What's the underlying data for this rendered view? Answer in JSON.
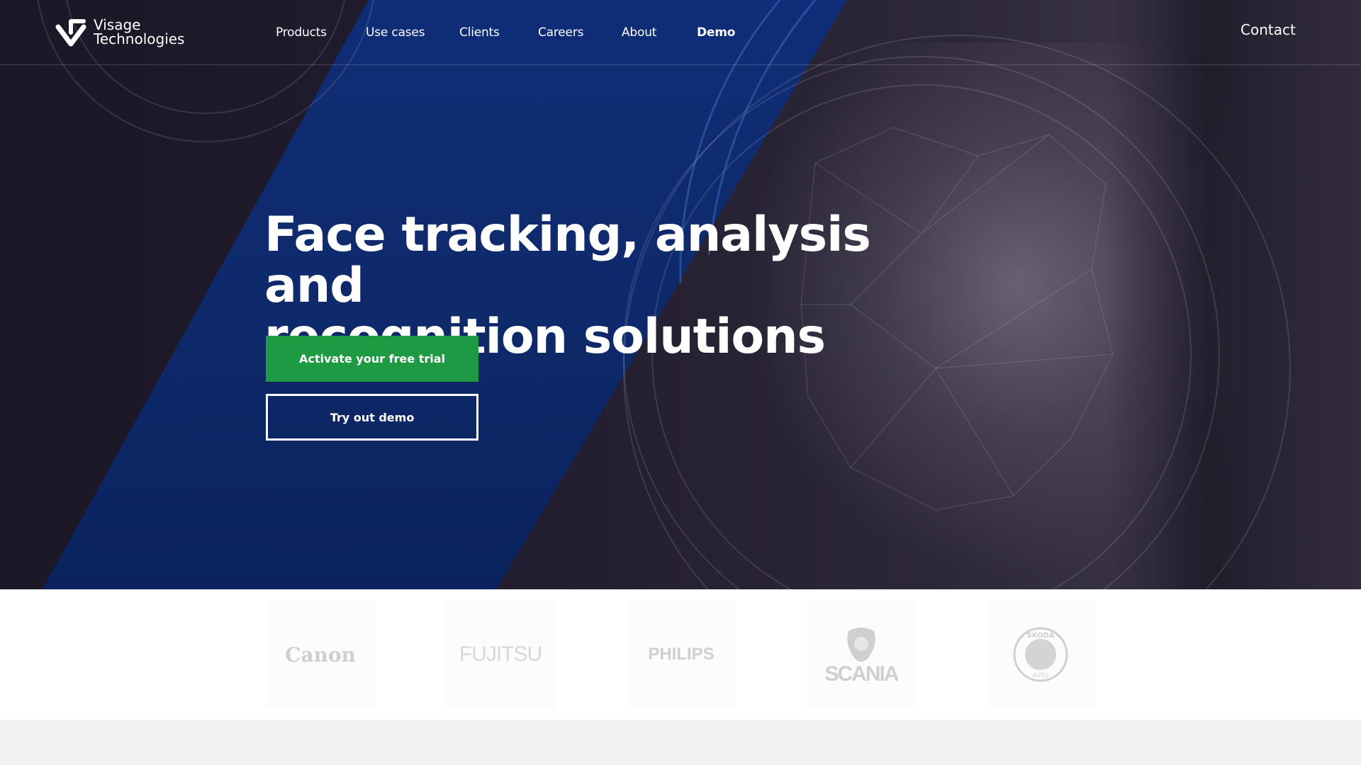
{
  "brand": {
    "name_line1": "Visage",
    "name_line2": "Technologies",
    "logo_icon": "visage-v-mark-icon"
  },
  "nav": {
    "items": [
      {
        "label": "Products",
        "active": false
      },
      {
        "label": "Use cases",
        "active": false
      },
      {
        "label": "Clients",
        "active": false
      },
      {
        "label": "Careers",
        "active": false
      },
      {
        "label": "About",
        "active": false
      },
      {
        "label": "Demo",
        "active": true
      }
    ],
    "contact_label": "Contact"
  },
  "hero": {
    "headline_line1": "Face tracking, analysis and",
    "headline_line2": "recognition solutions",
    "primary_cta": "Activate your free trial",
    "secondary_cta": "Try out demo"
  },
  "clients": {
    "logos": [
      {
        "name": "Canon",
        "text": "Canon"
      },
      {
        "name": "Fujitsu",
        "text": "FUJITSU"
      },
      {
        "name": "Philips",
        "text": "PHILIPS"
      },
      {
        "name": "Scania",
        "text": "SCANIA"
      },
      {
        "name": "Skoda",
        "text_top": "SKODA",
        "text_bottom": "AUTO"
      }
    ]
  },
  "colors": {
    "primary_green": "#1e9a45",
    "hero_blue": "#0f2a6b",
    "hero_dark": "#1e1a2c",
    "logo_grey": "#cfcfcf",
    "page_bg": "#f1f1f3"
  }
}
